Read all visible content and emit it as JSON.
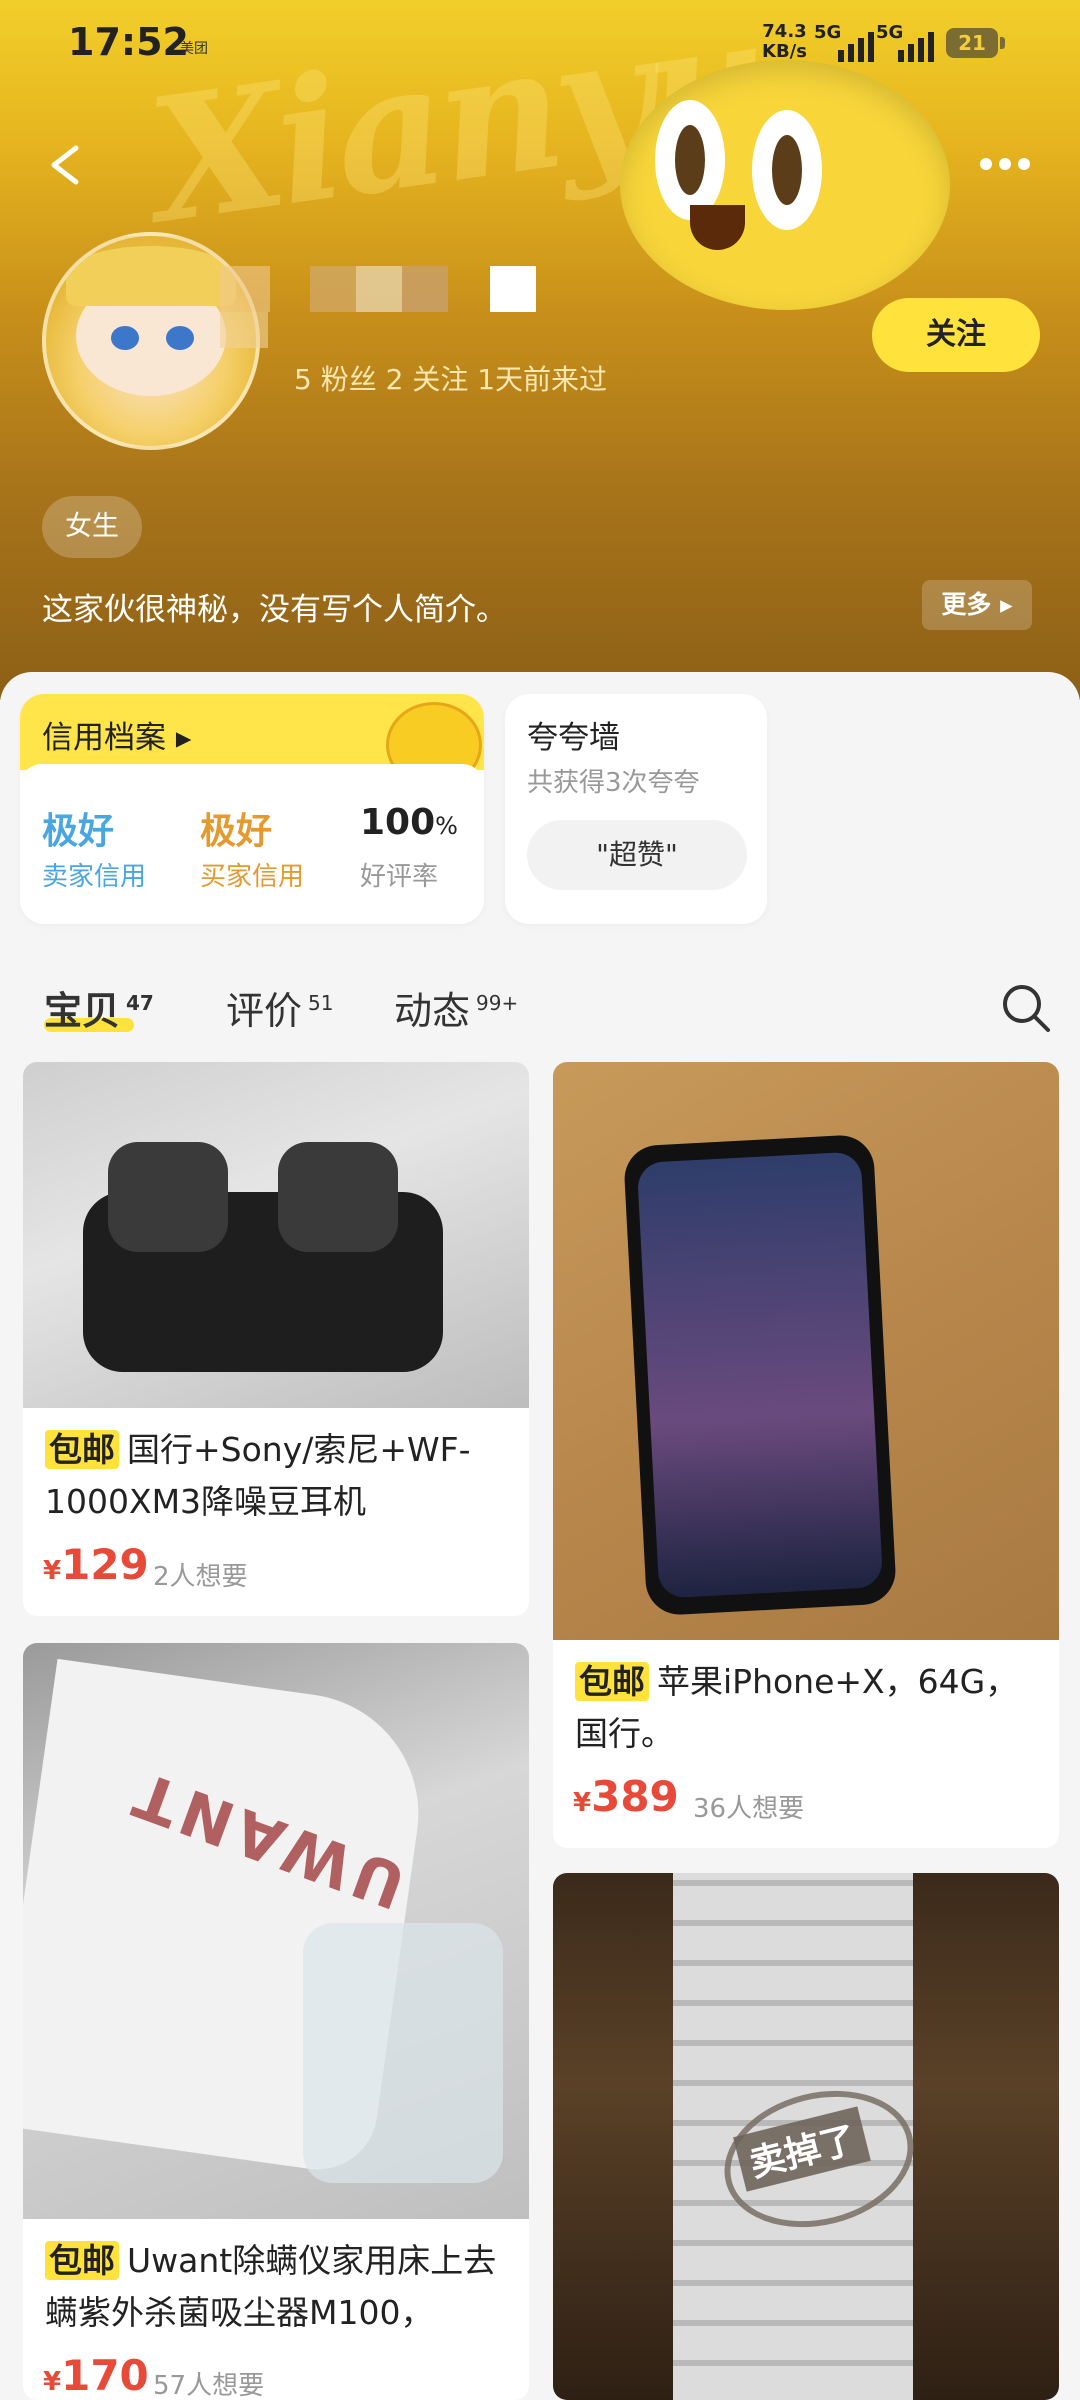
{
  "status": {
    "time": "17:52",
    "app_badge": "美团",
    "net_speed": "74.3",
    "net_unit": "KB/s",
    "sig1": "5G",
    "sig2": "5G",
    "battery": "21"
  },
  "profile": {
    "stats": "5 粉丝   2 关注   1天前来过",
    "follow_label": "关注",
    "gender": "女生",
    "bio": "这家伙很神秘，没有写个人简介。",
    "more_label": "更多 ▸"
  },
  "credit": {
    "title": "信用档案 ▸",
    "seller_value": "极好",
    "seller_label": "卖家信用",
    "buyer_value": "极好",
    "buyer_label": "买家信用",
    "rate_value": "100",
    "rate_unit": "%",
    "rate_label": "好评率"
  },
  "praise": {
    "title": "夸夸墙",
    "subtitle": "共获得3次夸夸",
    "tag": "\"超赞\""
  },
  "tabs": [
    {
      "label": "宝贝",
      "count": "47"
    },
    {
      "label": "评价",
      "count": "51"
    },
    {
      "label": "动态",
      "count": "99+"
    }
  ],
  "items": [
    {
      "tag": "包邮",
      "title": "国行+Sony/索尼+WF-1000XM3降噪豆耳机",
      "currency": "¥",
      "price": "129",
      "want": "2人想要"
    },
    {
      "tag": "包邮",
      "title": "苹果iPhone+X，64G，国行。",
      "currency": "¥",
      "price": "389",
      "want": "36人想要"
    },
    {
      "tag": "包邮",
      "title": "Uwant除螨仪家用床上去螨紫外杀菌吸尘器M100，",
      "currency": "¥",
      "price": "170",
      "want": "57人想要"
    },
    {
      "stamp": "卖掉了"
    }
  ],
  "colors": {
    "accent": "#ffe23b",
    "price": "#e84a3a",
    "seller_blue": "#4aa6e0",
    "buyer_orange": "#e39a2e"
  }
}
